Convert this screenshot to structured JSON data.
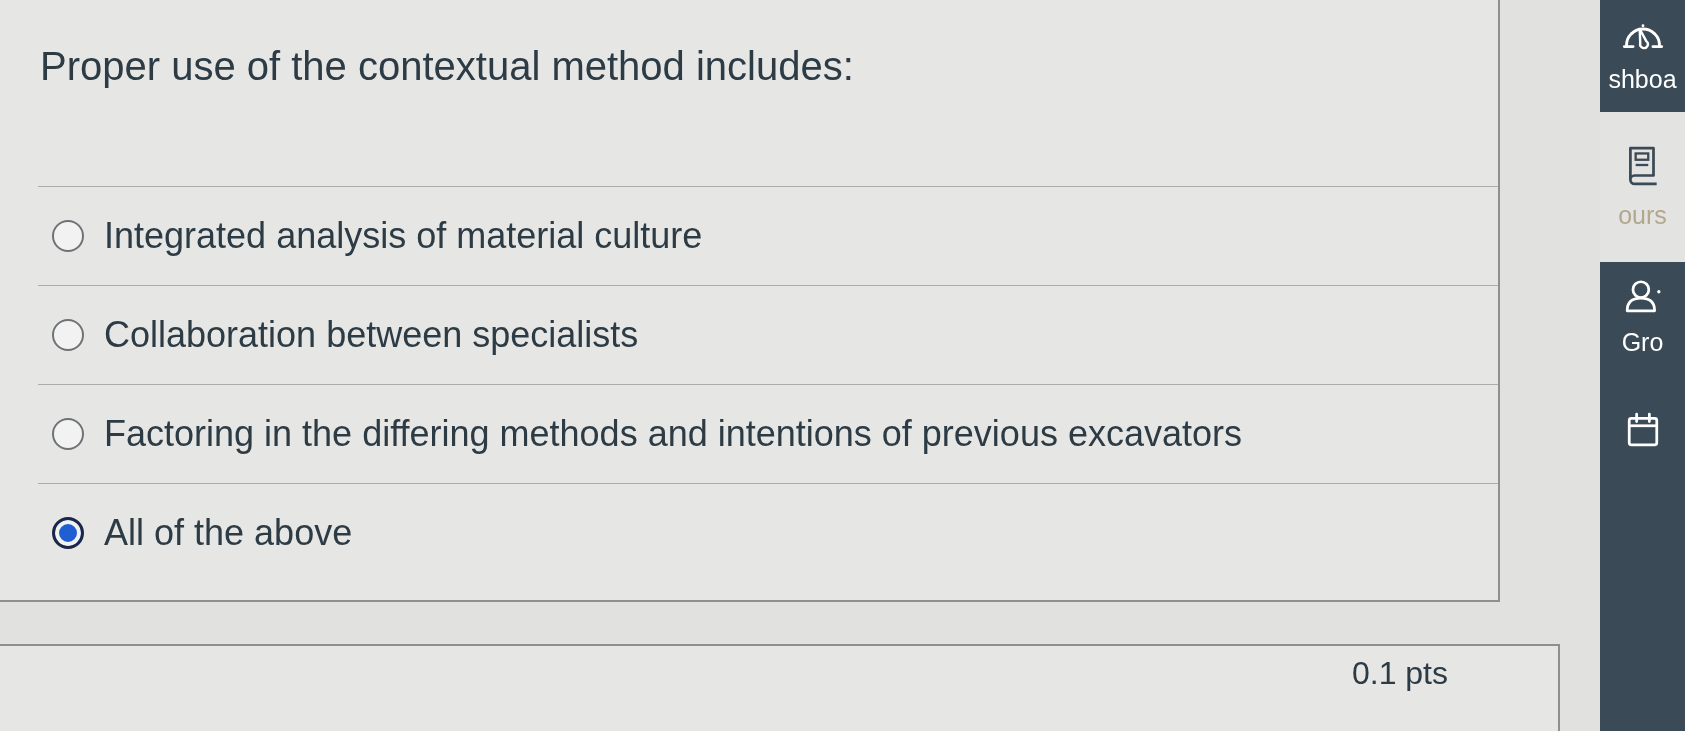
{
  "question": {
    "text": "Proper use of the contextual method includes:",
    "options": [
      {
        "label": "Integrated analysis of material culture",
        "selected": false
      },
      {
        "label": "Collaboration between specialists",
        "selected": false
      },
      {
        "label": "Factoring in the differing methods and intentions of previous excavators",
        "selected": false
      },
      {
        "label": "All of the above",
        "selected": true
      }
    ]
  },
  "next_question": {
    "points": "0.1 pts"
  },
  "global_nav": {
    "items": [
      {
        "kind": "dashboard",
        "label": "shboa",
        "selected": false
      },
      {
        "kind": "courses",
        "label": "ours",
        "selected": true
      },
      {
        "kind": "groups",
        "label": "Gro",
        "selected": false
      },
      {
        "kind": "calendar",
        "selected": false
      }
    ]
  }
}
